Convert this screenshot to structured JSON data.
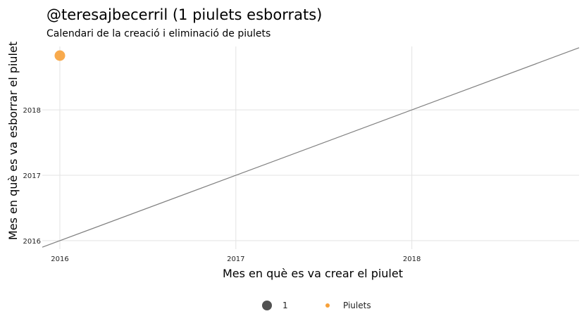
{
  "chart_data": {
    "type": "scatter",
    "title": "@teresajbecerril (1 piulets esborrats)",
    "subtitle": "Calendari de la creació i eliminació de piulets",
    "xlabel": "Mes en què es va crear el piulet",
    "ylabel": "Mes en què es va esborrar el piulet",
    "x_ticks": [
      2016,
      2017,
      2018
    ],
    "y_ticks": [
      2016,
      2017,
      2018
    ],
    "x_tick_labels": [
      "2016",
      "2017",
      "2018"
    ],
    "y_tick_labels": [
      "2016",
      "2017",
      "2018"
    ],
    "xlim": [
      2015.9,
      2018.95
    ],
    "ylim": [
      2015.87,
      2018.97
    ],
    "grid": true,
    "reference_line": {
      "type": "identity",
      "color": "#808080"
    },
    "points": [
      {
        "x": 2016.0,
        "y": 2018.83,
        "size": 1,
        "color": "#F7A13A"
      }
    ],
    "legend": {
      "placement": "bottom",
      "size_entries": [
        {
          "label": "1",
          "color": "#333333"
        }
      ],
      "color_entries": [
        {
          "label": "Piulets",
          "color": "#F7A13A"
        }
      ]
    }
  }
}
